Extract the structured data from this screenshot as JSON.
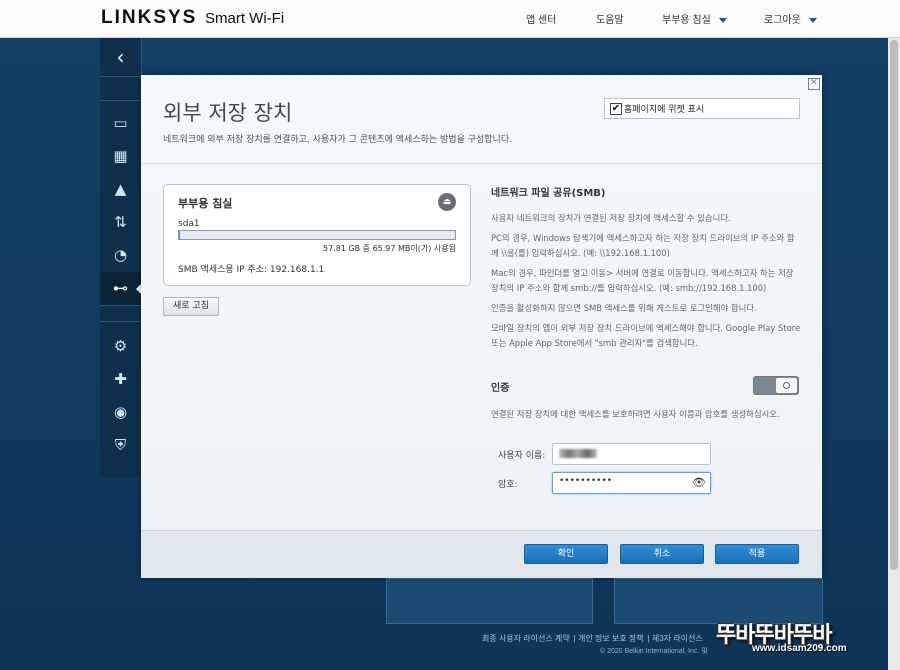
{
  "header": {
    "brand": "LINKSYS",
    "brand_suffix": "Smart Wi-Fi",
    "nav": [
      {
        "label": "앱 센터",
        "has_caret": false
      },
      {
        "label": "도움말",
        "has_caret": false
      },
      {
        "label": "부부용 침실",
        "has_caret": true
      },
      {
        "label": "로그아웃",
        "has_caret": true
      }
    ]
  },
  "sidebar": {
    "back_icon": "chevron-left-icon",
    "items": [
      {
        "icon": "devices-icon",
        "glyph": "▭",
        "active": false
      },
      {
        "icon": "calendar-icon",
        "glyph": "▦",
        "active": false
      },
      {
        "icon": "warning-icon",
        "glyph": "▲",
        "active": false
      },
      {
        "icon": "bandwidth-icon",
        "glyph": "⇅",
        "active": false
      },
      {
        "icon": "speedometer-icon",
        "glyph": "◔",
        "active": false
      },
      {
        "icon": "usb-icon",
        "glyph": "⊷",
        "active": true
      },
      {
        "icon": "settings-icon",
        "glyph": "⚙",
        "active": false
      },
      {
        "icon": "health-icon",
        "glyph": "✚",
        "active": false
      },
      {
        "icon": "wifi-icon",
        "glyph": "◉",
        "active": false
      },
      {
        "icon": "security-icon",
        "glyph": "⛨",
        "active": false
      }
    ]
  },
  "modal": {
    "title": "외부 저장 장치",
    "description": "네트워크에 외부 저장 장치를 연결하고, 사용자가 그 콘텐츠에 액세스하는 방법을 구성합니다.",
    "show_widget_label": "홈페이지에 위젯 표시",
    "show_widget_checked": true,
    "device": {
      "name": "부부용 침실",
      "partition": "sda1",
      "usage_text": "57.81 GB 중 65.97 MB이(가) 사용됨",
      "usage_fraction": 0.0011,
      "smb_ip_text": "SMB 액세스용 IP 주소: 192.168.1.1"
    },
    "refresh_label": "새로 고침",
    "smb": {
      "title": "네트워크 파일 공유(SMB)",
      "paragraphs": [
        "사용자 네트워크의 장치가 연결된 저장 장치에 액세스할 수 있습니다.",
        "PC의 경우, Windows 탐색기에 액세스하고자 하는 저장 장치 드라이브의 IP 주소와 함께 \\\\을(를) 입력하십시오. (예: \\\\192.168.1.100)",
        "Mac의 경우, 파인더를 열고 이동> 서버에 연결로 이동합니다. 액세스하고자 하는 저장 장치의 IP 주소와 함께 smb://를 입력하십시오. (예: smb://192.168.1.100)",
        "인증을 활성화하지 않으면 SMB 액세스를 위해 게스트로 로그인해야 합니다.",
        "모바일 장치의 앱이 외부 저장 장치 드라이브에 액세스해야 합니다. Google Play Store 또는 Apple App Store에서 \"smb 관리자\"를 검색합니다."
      ]
    },
    "auth": {
      "title": "인증",
      "enabled": false,
      "description": "연결된 저장 장치에 대한 액세스를 보호하려면 사용자 이름과 암호를 생성하십시오.",
      "username_label": "사용자 이름:",
      "password_label": "암호:",
      "password_value": "••••••••••"
    },
    "buttons": {
      "ok": "확인",
      "cancel": "취소",
      "apply": "적용"
    }
  },
  "footer": {
    "links": [
      "최종 사용자 라이선스 계약",
      "개인 정보 보호 정책",
      "제3자 라이선스"
    ],
    "copyright": "© 2020 Belkin International, Inc. 및"
  },
  "watermark": {
    "logo_text": "뚜바뚜바뚜바",
    "url": "www.idsam209.com"
  },
  "colors": {
    "brand_blue": "#1c5a8c",
    "primary_button": "#2580c8",
    "background": "#0d3a5e"
  }
}
